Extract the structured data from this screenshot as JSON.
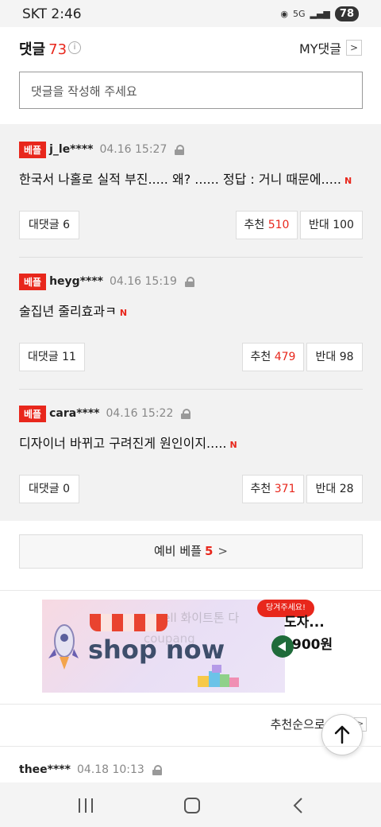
{
  "status": {
    "time": "SKT 2:46",
    "battery": "78",
    "net": "5G"
  },
  "header": {
    "title": "댓글",
    "count": "73",
    "info": "i",
    "my_label": "MY댓글",
    "my_chevron": ">"
  },
  "input": {
    "placeholder": "댓글을 작성해 주세요"
  },
  "comments": [
    {
      "badge": "베플",
      "user": "j_le****",
      "time": "04.16 15:27",
      "text": "한국서 나홀로 실적 부진..... 왜? ...... 정답 : 거니 때문에.....",
      "new": "N",
      "reply_label": "대댓글 6",
      "up_label": "추천",
      "up": "510",
      "down_label": "반대",
      "down": "100"
    },
    {
      "badge": "베플",
      "user": "heyg****",
      "time": "04.16 15:19",
      "text": "술집년 줄리효과ㅋ",
      "new": "N",
      "reply_label": "대댓글 11",
      "up_label": "추천",
      "up": "479",
      "down_label": "반대",
      "down": "98"
    },
    {
      "badge": "베플",
      "user": "cara****",
      "time": "04.16 15:22",
      "text": "디자이너 바뀌고 구려진게 원인이지.....",
      "new": "N",
      "reply_label": "대댓글 0",
      "up_label": "추천",
      "up": "371",
      "down_label": "반대",
      "down": "28"
    }
  ],
  "more": {
    "label": "예비 베플",
    "count": "5",
    "chevron": ">"
  },
  "ad": {
    "faint_text": "...sell 화이트톤 다",
    "faint_text2": "coupang",
    "image_text": "shop now",
    "tag": "당겨주세요!",
    "title": "도자...",
    "price": "900원"
  },
  "sort": {
    "label": "추천순으로 보기",
    "chevron": ">"
  },
  "last_comment": {
    "user": "thee****",
    "time": "04.18 10:13"
  }
}
